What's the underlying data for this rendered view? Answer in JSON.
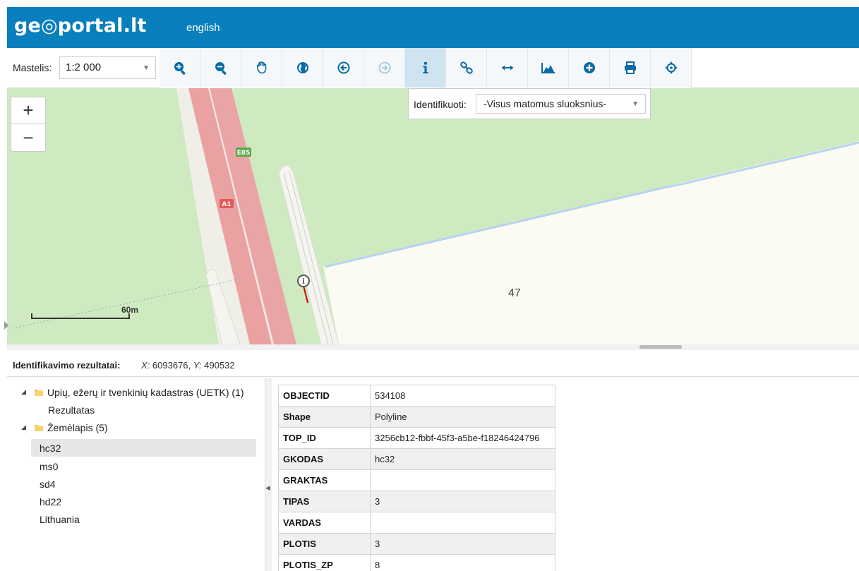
{
  "header": {
    "logo": "ge◎portal.lt",
    "language_link": "english"
  },
  "toolbar": {
    "scale_label": "Mastelis:",
    "scale_value": "1:2 000",
    "tools": [
      {
        "name": "zoom-in-tool",
        "icon": "zoom-in-icon",
        "active": false
      },
      {
        "name": "zoom-out-tool",
        "icon": "zoom-out-icon",
        "active": false
      },
      {
        "name": "pan-tool",
        "icon": "hand-icon",
        "active": false
      },
      {
        "name": "full-extent-tool",
        "icon": "globe-icon",
        "active": false
      },
      {
        "name": "previous-extent-tool",
        "icon": "back-arrow-icon",
        "active": false
      },
      {
        "name": "next-extent-tool",
        "icon": "forward-arrow-icon",
        "active": false
      },
      {
        "name": "identify-tool",
        "icon": "info-icon",
        "active": true
      },
      {
        "name": "link-tool",
        "icon": "link-icon",
        "active": false
      },
      {
        "name": "measure-tool",
        "icon": "horizontal-arrows-icon",
        "active": false
      },
      {
        "name": "elevation-profile-tool",
        "icon": "mountain-icon",
        "active": false
      },
      {
        "name": "add-data-tool",
        "icon": "plus-circle-icon",
        "active": false
      },
      {
        "name": "print-tool",
        "icon": "printer-icon",
        "active": false
      },
      {
        "name": "locate-tool",
        "icon": "crosshair-icon",
        "active": false
      }
    ]
  },
  "identify": {
    "label": "Identifikuoti:",
    "selected": "-Visus matomus sluoksnius-"
  },
  "map": {
    "road_labels": [
      "E85",
      "A1"
    ],
    "parcel_label": "47",
    "scalebar_label": "60m",
    "colors": {
      "grass": "#cfe9c1",
      "land": "#fbfbf3",
      "road": "#eaa1a1",
      "water": "#b8d3ee"
    }
  },
  "results": {
    "title": "Identifikavimo rezultatai:",
    "x_label": "X:",
    "x_value": "6093676,",
    "y_label": "Y:",
    "y_value": "490532"
  },
  "tree": [
    {
      "label": "Upių, ežerų ir tvenkinių kadastras (UETK) (1)",
      "level": 0,
      "folder": true,
      "selected": false
    },
    {
      "label": "Rezultatas",
      "level": 1,
      "folder": false,
      "selected": false
    },
    {
      "label": "Žemėlapis (5)",
      "level": 0,
      "folder": true,
      "selected": false
    },
    {
      "label": "hc32",
      "level": 1,
      "folder": false,
      "selected": true
    },
    {
      "label": "ms0",
      "level": 1,
      "folder": false,
      "selected": false
    },
    {
      "label": "sd4",
      "level": 1,
      "folder": false,
      "selected": false
    },
    {
      "label": "hd22",
      "level": 1,
      "folder": false,
      "selected": false
    },
    {
      "label": "Lithuania",
      "level": 1,
      "folder": false,
      "selected": false
    }
  ],
  "attributes": [
    {
      "key": "OBJECTID",
      "value": "534108"
    },
    {
      "key": "Shape",
      "value": "Polyline"
    },
    {
      "key": "TOP_ID",
      "value": "3256cb12-fbbf-45f3-a5be-f18246424796"
    },
    {
      "key": "GKODAS",
      "value": "hc32"
    },
    {
      "key": "GRAKTAS",
      "value": ""
    },
    {
      "key": "TIPAS",
      "value": "3"
    },
    {
      "key": "VARDAS",
      "value": ""
    },
    {
      "key": "PLOTIS",
      "value": "3"
    },
    {
      "key": "PLOTIS_ZP",
      "value": "8"
    }
  ]
}
